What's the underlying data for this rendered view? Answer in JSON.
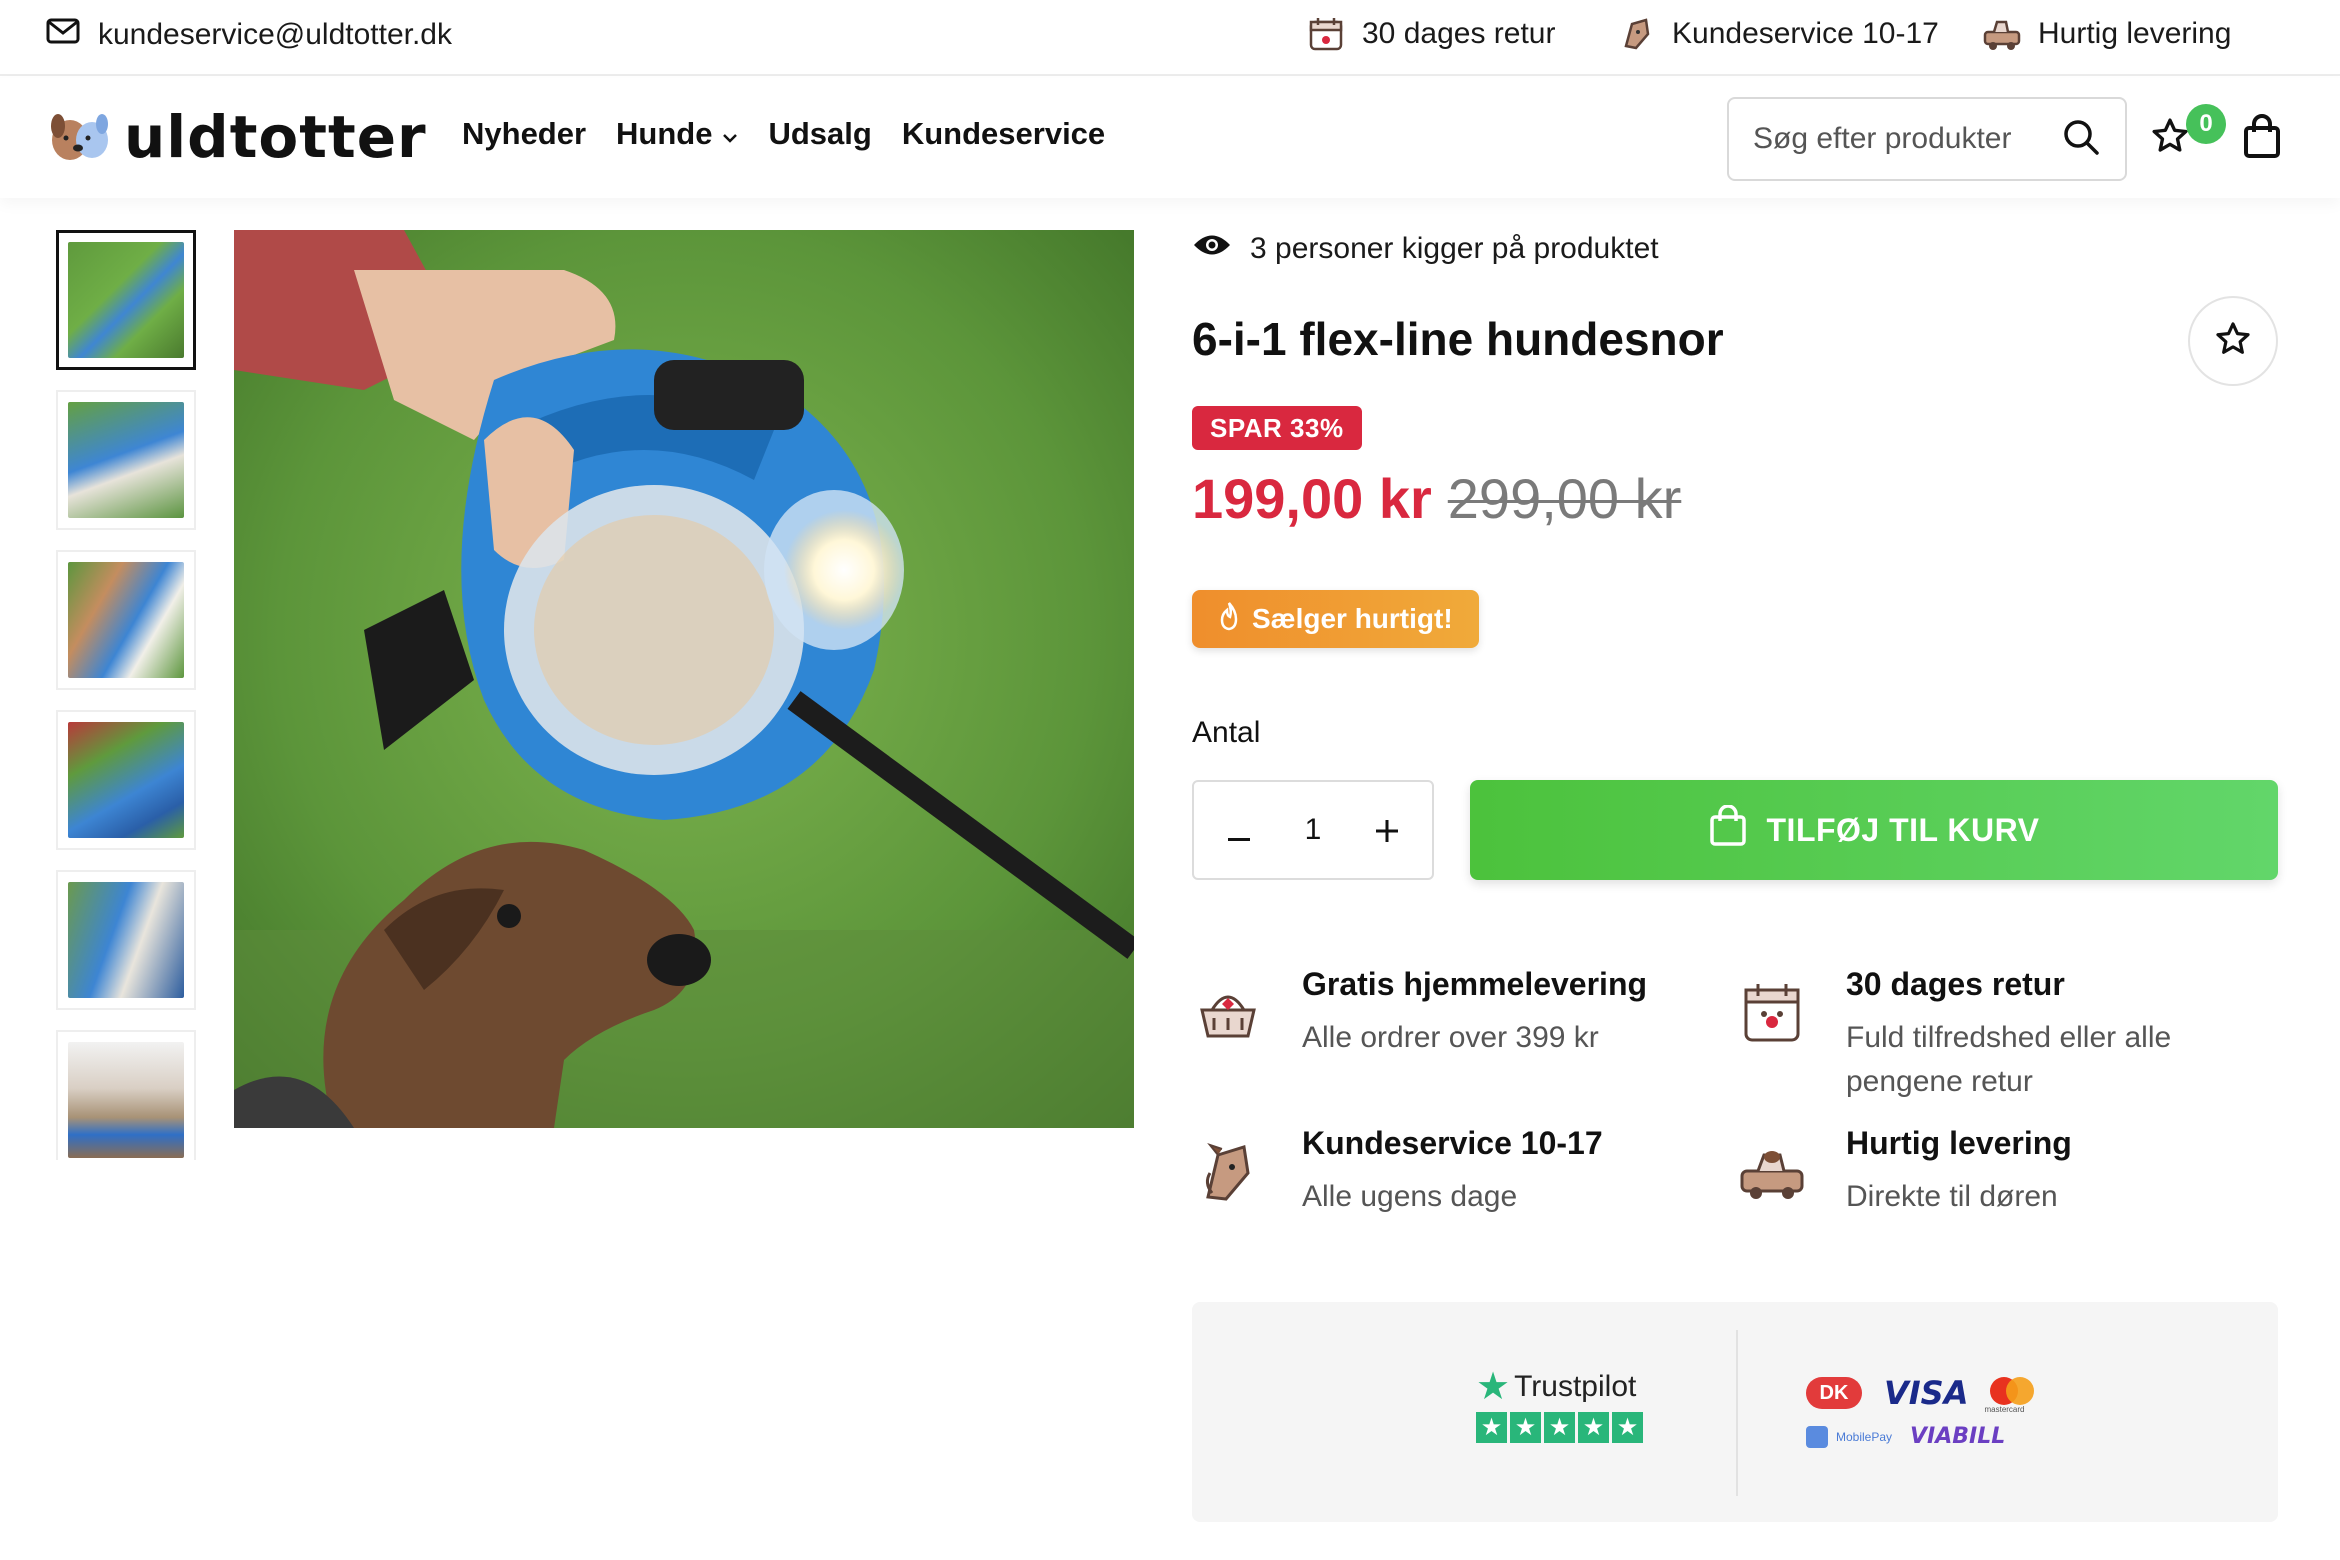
{
  "topbar": {
    "email": "kundeservice@uldtotter.dk",
    "usps": [
      "30 dages retur",
      "Kundeservice 10-17",
      "Hurtig levering"
    ]
  },
  "header": {
    "logo_text": "uldtotter",
    "nav": [
      "Nyheder",
      "Hunde",
      "Udsalg",
      "Kundeservice"
    ],
    "search_placeholder": "Søg efter produkter",
    "wishlist_count": "0"
  },
  "product": {
    "viewing": "3 personer kigger på produktet",
    "title": "6-i-1 flex-line hundesnor",
    "save_badge": "SPAR 33%",
    "price_now": "199,00 kr",
    "price_old": "299,00 kr",
    "hot_badge": "Sælger hurtigt!",
    "qty_label": "Antal",
    "qty_value": "1",
    "add_to_cart": "TILFØJ TIL KURV"
  },
  "features": [
    {
      "title": "Gratis hjemmelevering",
      "sub": "Alle ordrer over 399 kr",
      "icon": "basket-icon"
    },
    {
      "title": "30 dages retur",
      "sub": "Fuld tilfredshed eller alle pengene retur",
      "icon": "calendar-paw-icon"
    },
    {
      "title": "Kundeservice 10-17",
      "sub": "Alle ugens dage",
      "icon": "dog-phone-icon"
    },
    {
      "title": "Hurtig levering",
      "sub": "Direkte til døren",
      "icon": "dog-car-icon"
    }
  ],
  "trust": {
    "trustpilot": "Trustpilot",
    "payments": [
      "DK",
      "VISA",
      "mastercard",
      "MobilePay",
      "VIABILL"
    ]
  },
  "gallery": {
    "thumb_count": 6,
    "active": 1
  },
  "colors": {
    "accent_red": "#d9283f",
    "green": "#4cc23c",
    "orange": "#ef8e2c",
    "trustpilot_green": "#29b67a"
  }
}
